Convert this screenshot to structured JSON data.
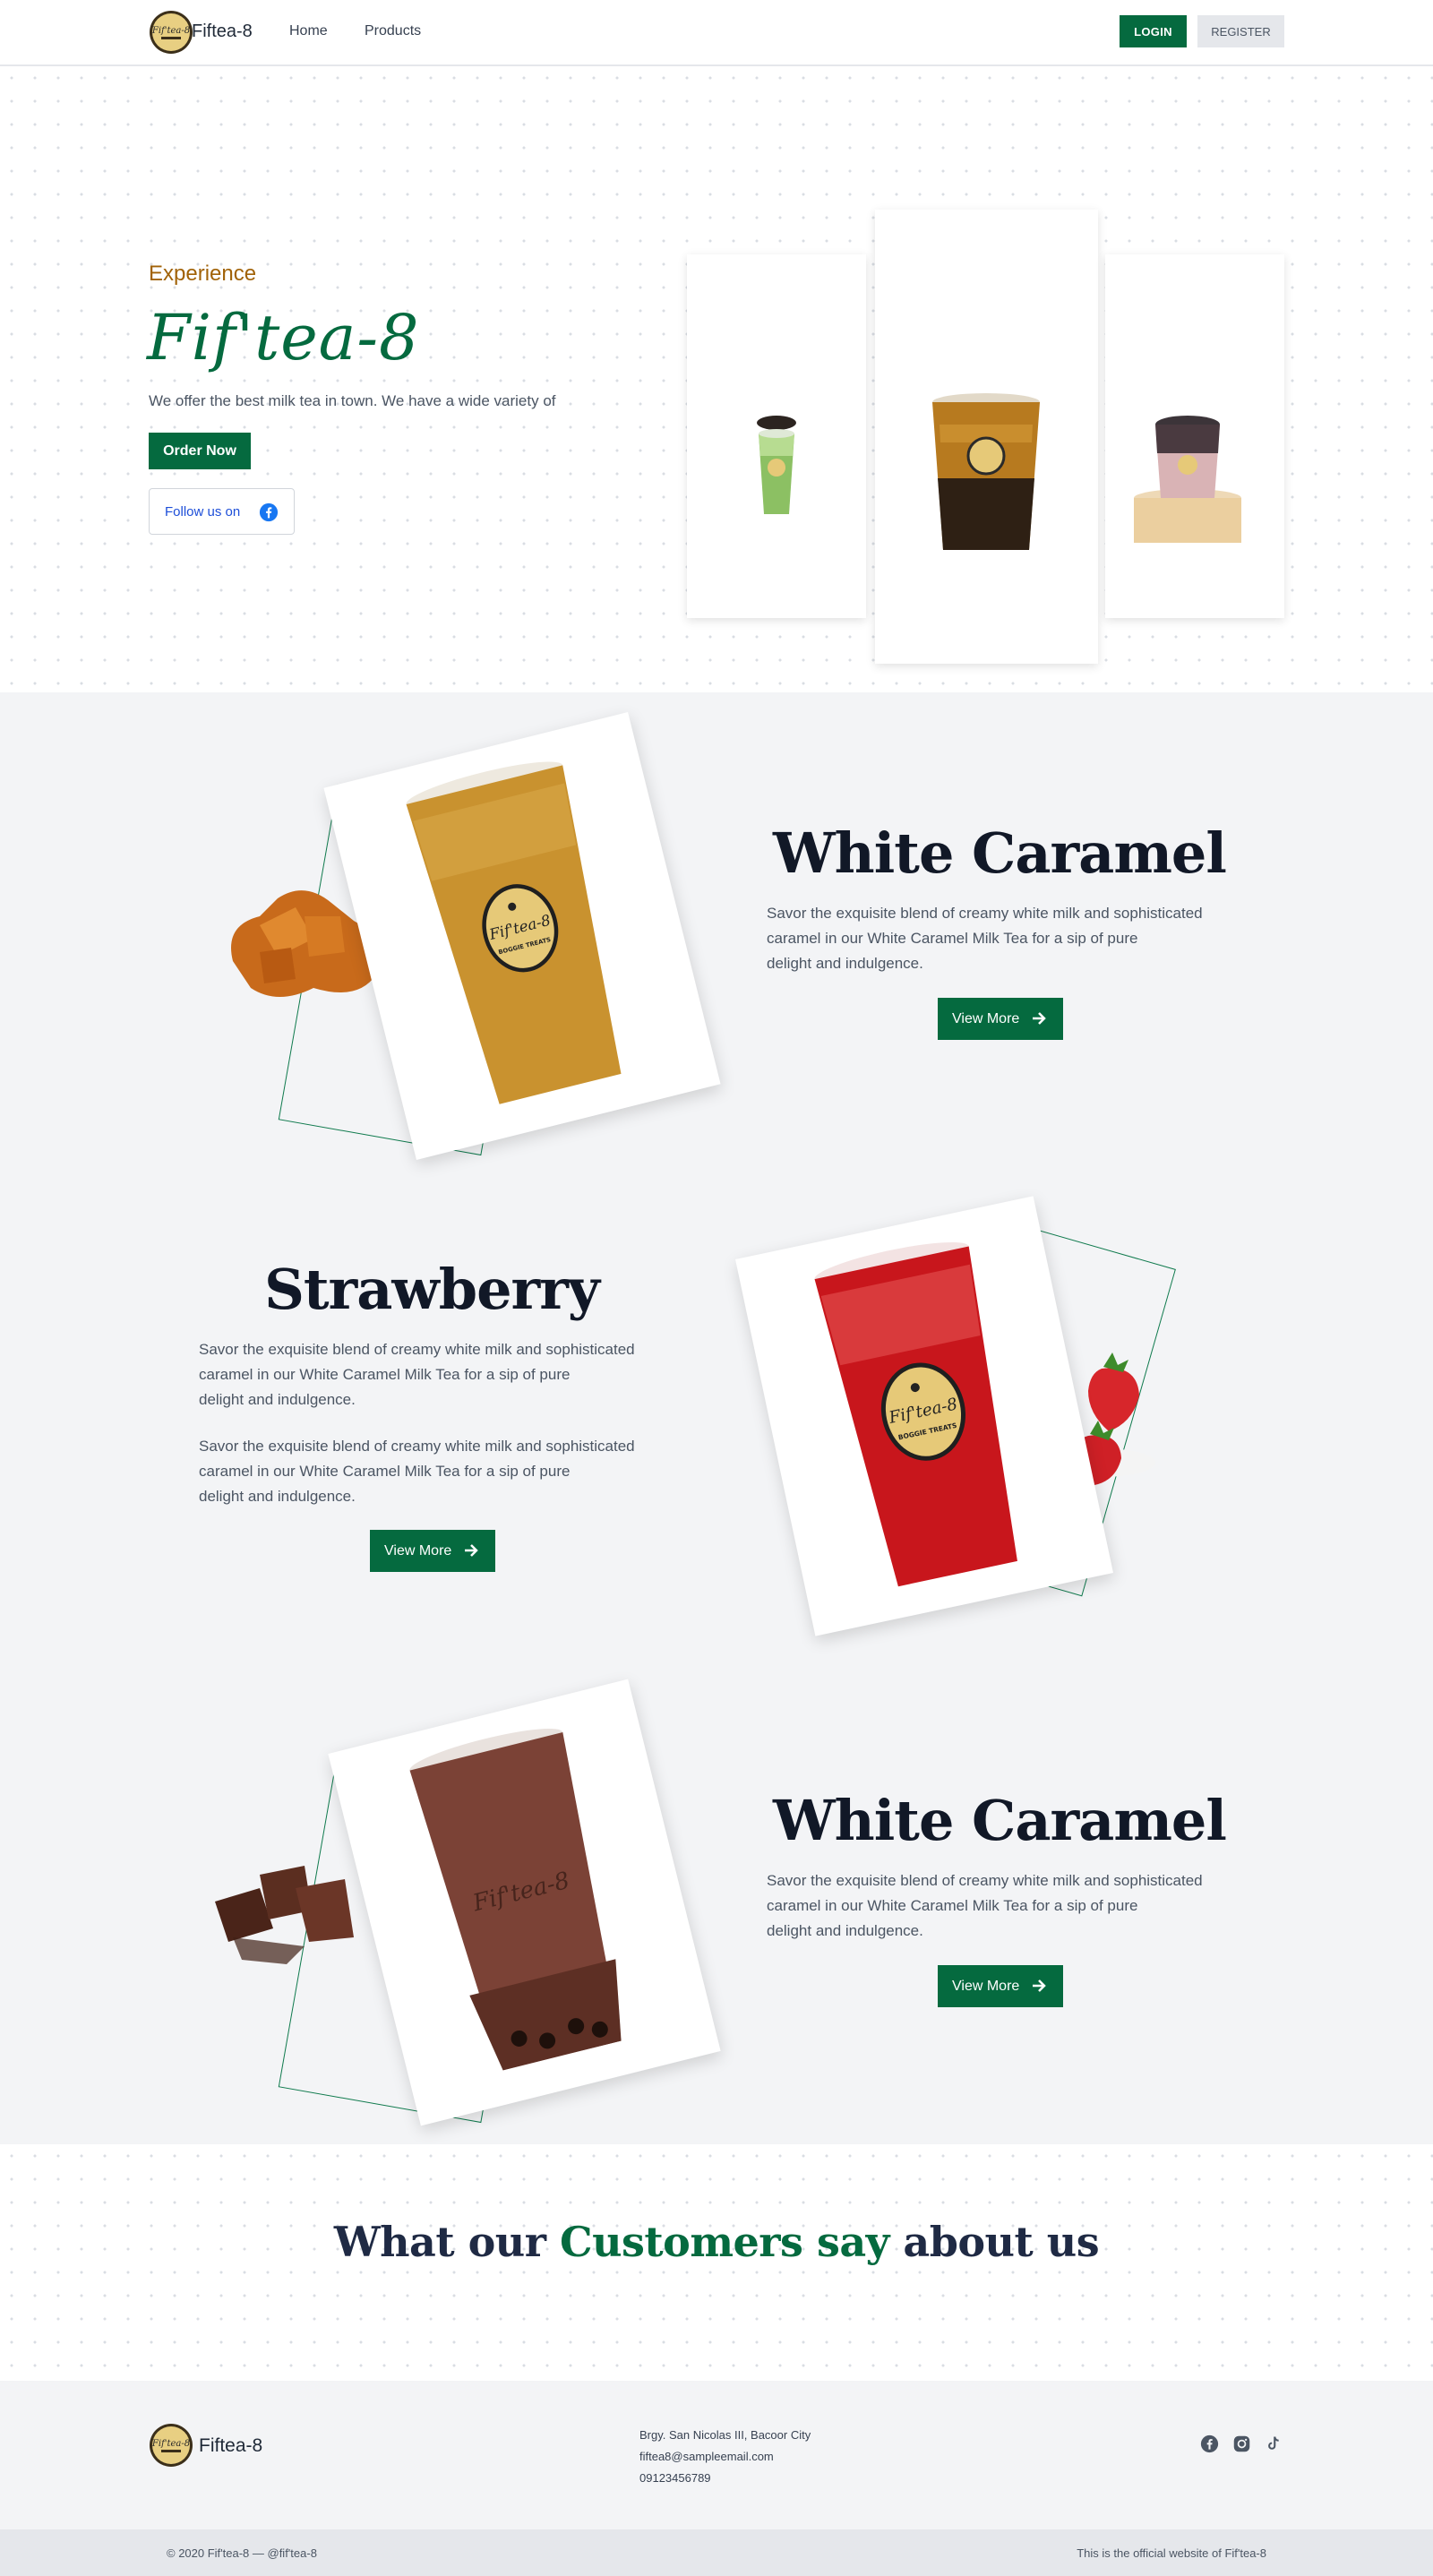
{
  "nav": {
    "brand": "Fiftea-8",
    "links": [
      "Home",
      "Products"
    ],
    "login_label": "LOGIN",
    "register_label": "REGISTER"
  },
  "hero": {
    "eyebrow": "Experience",
    "title": "Fif'tea-8",
    "subtitle": "We offer the best milk tea in town. We have a wide variety of",
    "order_label": "Order Now",
    "follow_label": "Follow us on"
  },
  "products": [
    {
      "title": "White Caramel",
      "description": [
        "Savor the exquisite blend of creamy white milk and sophisticated",
        "caramel in our White Caramel Milk Tea for a sip of pure",
        "delight and indulgence."
      ],
      "button_label": "View More"
    },
    {
      "title": "Strawberry",
      "description": [
        "Savor the exquisite blend of creamy white milk and sophisticated",
        "caramel in our White Caramel Milk Tea for a sip of pure",
        "delight and indulgence."
      ],
      "description2": [
        "Savor the exquisite blend of creamy white milk and sophisticated",
        "caramel in our White Caramel Milk Tea for a sip of pure",
        "delight and indulgence."
      ],
      "button_label": "View More"
    },
    {
      "title": "White Caramel",
      "description": [
        "Savor the exquisite blend of creamy white milk and sophisticated",
        "caramel in our White Caramel Milk Tea for a sip of pure",
        "delight and indulgence."
      ],
      "button_label": "View More"
    }
  ],
  "cup_label": {
    "logo": "Fif'tea-8",
    "tag": "BOGGIE TREATS"
  },
  "testimonials": {
    "part1": "What our ",
    "highlight": "Customers say",
    "part2": " about us"
  },
  "footer": {
    "brand": "Fiftea-8",
    "address": "Brgy. San Nicolas III, Bacoor City",
    "email": "fiftea8@sampleemail.com",
    "phone": "09123456789",
    "social_icons": [
      "facebook-icon",
      "instagram-icon",
      "tiktok-icon"
    ],
    "copyright": "© 2020 Fif'tea-8 —  @fif'tea-8",
    "official": "This is the official website of Fif'tea-8"
  },
  "colors": {
    "primary": "#056a3f",
    "accent": "#a16207",
    "heading": "#111827",
    "section_bg": "#f3f4f6"
  }
}
